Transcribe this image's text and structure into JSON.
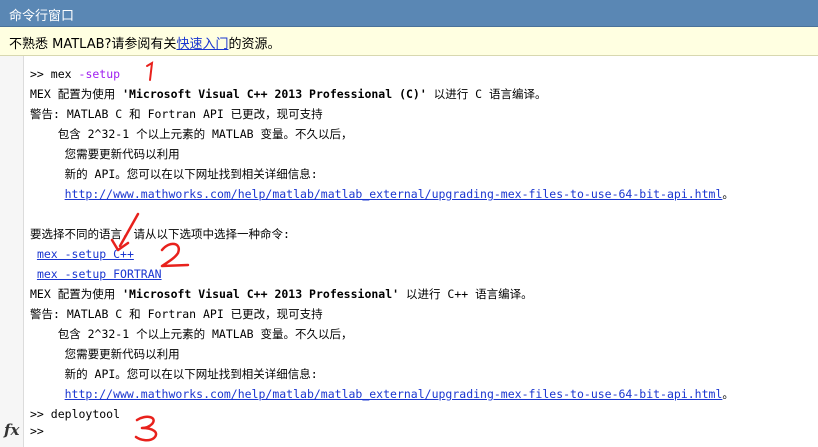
{
  "window": {
    "title": "命令行窗口"
  },
  "infobar": {
    "prefix": "不熟悉 MATLAB?请参阅有关",
    "link": "快速入门",
    "suffix": "的资源。"
  },
  "console": {
    "prompt": ">>",
    "cmd1": "mex -setup",
    "cfg1_prefix": "MEX 配置为使用 ",
    "cfg1_compiler": "'Microsoft Visual C++ 2013 Professional (C)'",
    "cfg1_suffix": " 以进行 C 语言编译。",
    "warn1_l1": "警告: MATLAB C 和 Fortran API 已更改，现可支持",
    "warn1_l2": "    包含 2^32-1 个以上元素的 MATLAB 变量。不久以后，",
    "warn1_l3": "     您需要更新代码以利用",
    "warn1_l4": "     新的 API。您可以在以下网址找到相关详细信息:",
    "url1": "http://www.mathworks.com/help/matlab/matlab_external/upgrading-mex-files-to-use-64-bit-api.html",
    "url1_suffix": "。",
    "choose_text": "要选择不同的语言，请从以下选项中选择一种命令:",
    "option_cpp": "mex -setup C++",
    "option_fortran": "mex -setup FORTRAN",
    "cfg2_prefix": "MEX 配置为使用 ",
    "cfg2_compiler": "'Microsoft Visual C++ 2013 Professional'",
    "cfg2_suffix": " 以进行 C++ 语言编译。",
    "warn2_l1": "警告: MATLAB C 和 Fortran API 已更改，现可支持",
    "warn2_l2": "    包含 2^32-1 个以上元素的 MATLAB 变量。不久以后，",
    "warn2_l3": "     您需要更新代码以利用",
    "warn2_l4": "     新的 API。您可以在以下网址找到相关详细信息:",
    "url2": "http://www.mathworks.com/help/matlab/matlab_external/upgrading-mex-files-to-use-64-bit-api.html",
    "url2_suffix": "。",
    "cmd2": "deploytool",
    "current_prompt": ">>"
  },
  "annotations": {
    "mark1": "1",
    "mark2": "2",
    "mark3": "3",
    "color": "#e8211c"
  },
  "icons": {
    "fx": "fx-icon"
  },
  "colors": {
    "titlebar": "#5a87b4",
    "infobar": "#ffffe1",
    "link": "#1a36d0",
    "keyword": "#a020f0"
  }
}
